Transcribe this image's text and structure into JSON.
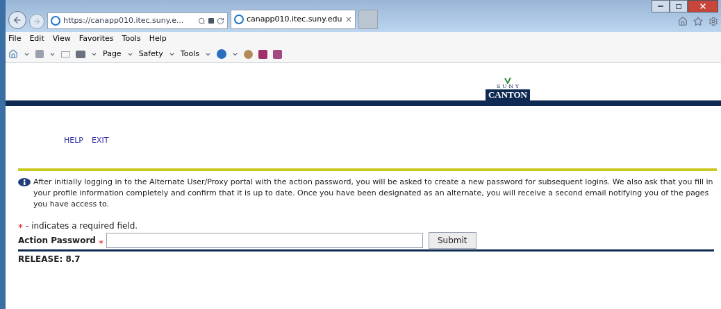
{
  "browser": {
    "address": "https://canapp010.itec.suny.e...",
    "tabs": [
      {
        "label": "canapp010.itec.suny.edu",
        "selected": true
      },
      {
        "selected": false
      }
    ],
    "close_tab": "×"
  },
  "menu_bar": [
    "File",
    "Edit",
    "View",
    "Favorites",
    "Tools",
    "Help"
  ],
  "command_bar": [
    "Page",
    "Safety",
    "Tools"
  ],
  "logo": {
    "top": "S U N Y",
    "bottom": "CANTON"
  },
  "nav_links": [
    "HELP",
    "EXIT"
  ],
  "info": "After initially logging in to the Alternate User/Proxy portal with the action password, you will be asked to create a new password for subsequent logins. We also ask that you fill in your profile information completely and confirm that it is up to date. Once you have been designated as an alternate, you will receive a second email notifying you of the pages you have access to.",
  "required_note": {
    "mark": "*",
    "text": "- indicates a required field."
  },
  "form": {
    "label": "Action Password",
    "required": true,
    "mark": "*",
    "button": "Submit"
  },
  "release": "RELEASE: 8.7"
}
